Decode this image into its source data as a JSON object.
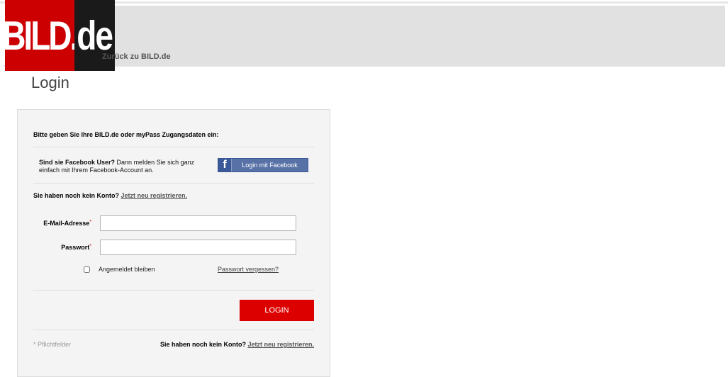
{
  "header": {
    "logo_left": "BILD",
    "logo_dot": ".",
    "logo_right": "de",
    "back_link": "Zurück zu BILD.de"
  },
  "page_title": "Login",
  "form": {
    "intro": "Bitte geben Sie Ihre BILD.de oder myPass Zugangsdaten ein:",
    "facebook": {
      "bold_text": "Sind sie Facebook User?",
      "text": " Dann melden Sie sich ganz einfach mit Ihrem Facebook-Account an.",
      "icon_glyph": "f",
      "button_label": "Login mit Facebook"
    },
    "register_prompt": "Sie haben noch kein Konto?",
    "register_link": "Jetzt neu registrieren.",
    "email": {
      "label": "E-Mail-Adresse",
      "value": "",
      "placeholder": ""
    },
    "password": {
      "label": "Passwort",
      "value": "",
      "placeholder": ""
    },
    "required_marker": "*",
    "remember_label": "Angemeldet bleiben",
    "forgot_link": "Passwort vergessen?",
    "login_button": "LOGIN",
    "required_note": "* Pflichtfelder"
  },
  "colors": {
    "brand_red": "#dd0000",
    "facebook_blue": "#5872a7",
    "header_bg": "#e1e1e1"
  }
}
